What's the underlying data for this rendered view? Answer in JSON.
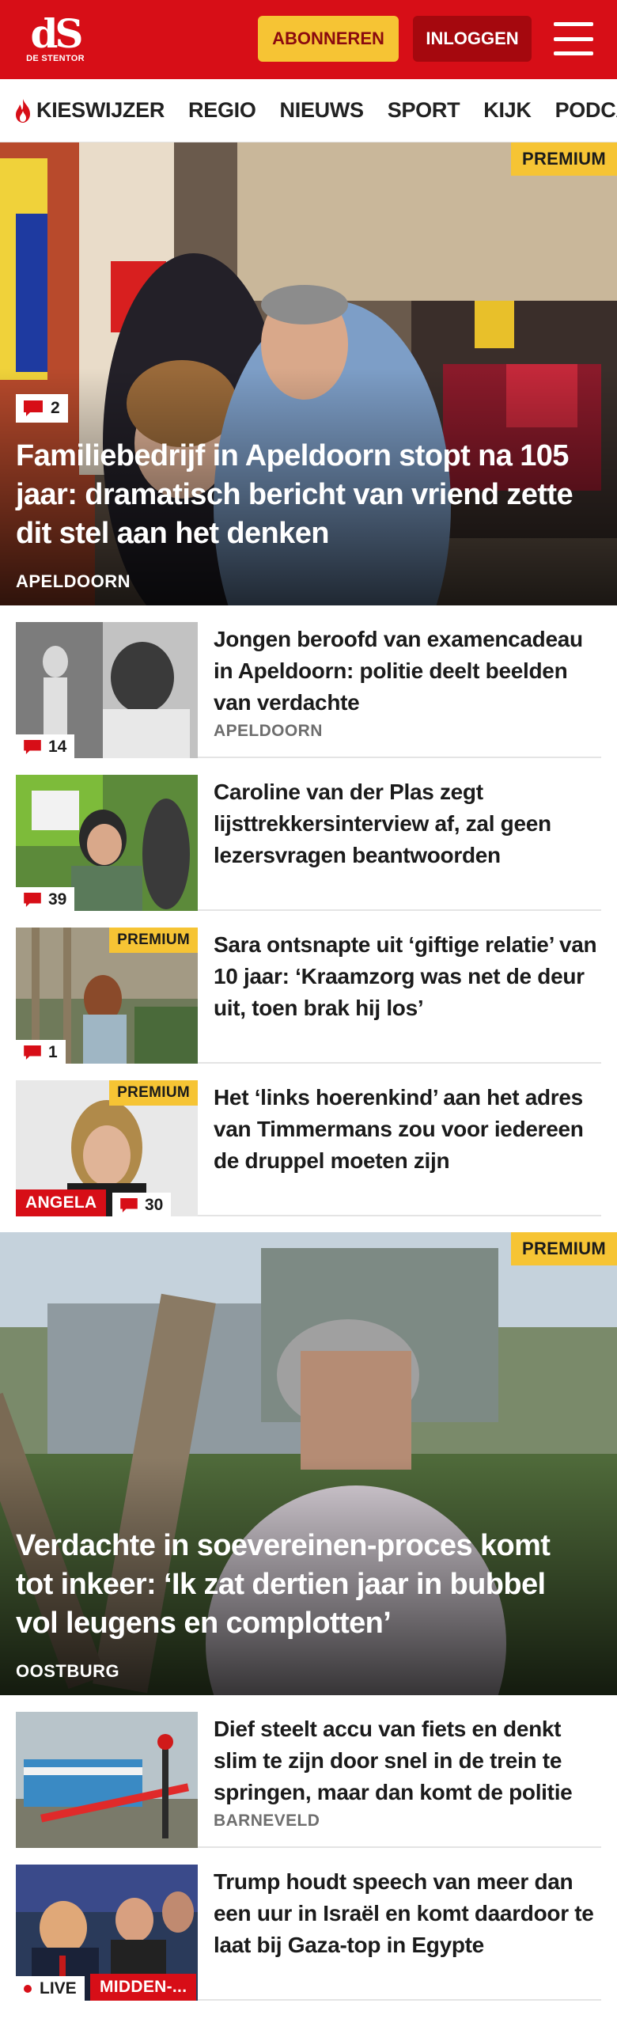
{
  "header": {
    "logo_mark": "dS",
    "logo_sub": "DE STENTOR",
    "subscribe_label": "ABONNEREN",
    "login_label": "INLOGGEN"
  },
  "nav": {
    "items": [
      "KIESWIJZER",
      "REGIO",
      "NIEUWS",
      "SPORT",
      "KIJK",
      "PODCAST"
    ]
  },
  "premium_label": "PREMIUM",
  "hero": {
    "comments": "2",
    "title": "Familiebedrijf in Apeldoorn stopt na 105 jaar: dramatisch bericht van vriend zette dit stel aan het denken",
    "location": "APELDOORN"
  },
  "articles": [
    {
      "title": "Jongen beroofd van examenca­deau in Apeldoorn: politie deelt beelden van verdachte",
      "location": "APELDOORN",
      "comments": "14"
    },
    {
      "title": "Caroline van der Plas zegt lijsttrekkersinterview af, zal geen lezersvragen beantwoor­den",
      "comments": "39"
    },
    {
      "title": "Sara ontsnapte uit ‘giftige relatie’ van 10 jaar: ‘Kraamzorg was net de deur uit, toen brak hij los’",
      "comments": "1"
    },
    {
      "title": "Het ‘links hoerenkind’ aan het adres van Timmermans zou voor iedereen de druppel moeten zijn",
      "label": "ANGELA",
      "comments": "30"
    }
  ],
  "hero2": {
    "title": "Verdachte in soevereinen-proces komt tot inkeer: ‘Ik zat dertien jaar in bubbel vol leugens en complotten’",
    "location": "OOSTBURG"
  },
  "articles2": [
    {
      "title": "Dief steelt accu van fiets en denkt slim te zijn door snel in de trein te springen, maar dan komt de politie",
      "location": "BARNEVELD"
    },
    {
      "title": "Trump houdt speech van meer dan een uur in Israël en komt daardoor te laat bij Gaza-top in Egypte",
      "live_label": "LIVE",
      "label": "MIDDEN-..."
    }
  ],
  "colors": {
    "brand_red": "#d70e17",
    "premium_yellow": "#f6c434",
    "login_dark_red": "#a5080e"
  }
}
